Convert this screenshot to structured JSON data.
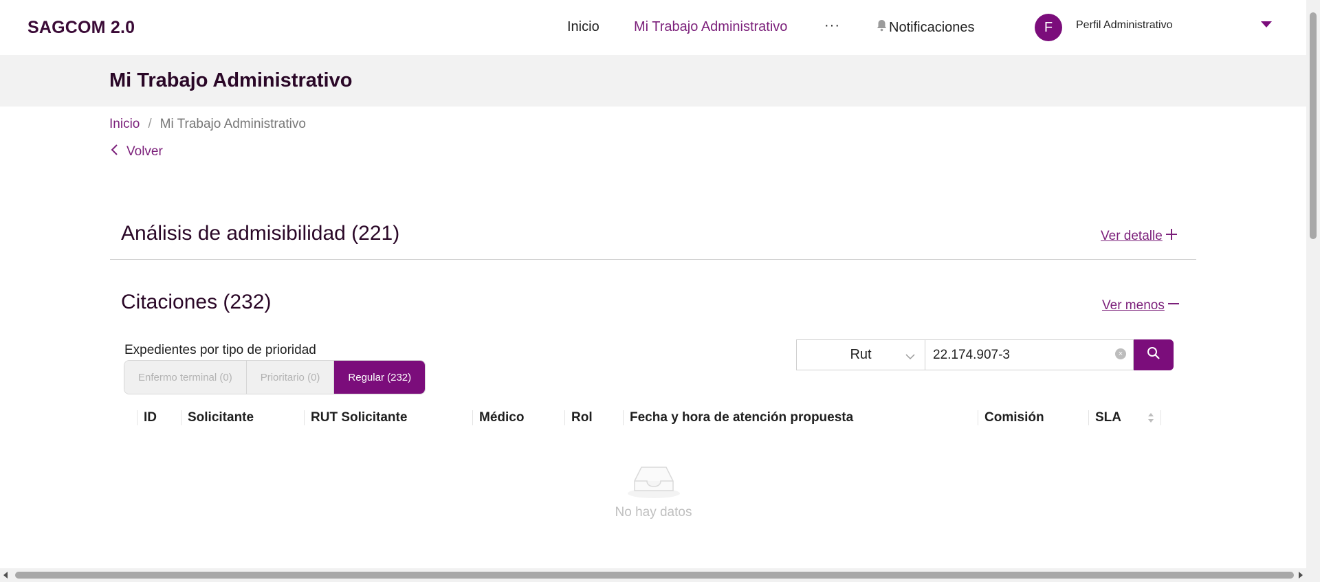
{
  "header": {
    "brand": "SAGCOM 2.0",
    "nav": [
      "Inicio",
      "Mi Trabajo Administrativo"
    ],
    "more": "···",
    "notifications": "Notificaciones",
    "avatar_initial": "F",
    "profile": "Perfil Administrativo"
  },
  "page": {
    "title": "Mi Trabajo Administrativo",
    "breadcrumb": [
      "Inicio",
      "Mi Trabajo Administrativo"
    ],
    "breadcrumb_sep": "/",
    "back": "Volver"
  },
  "sections": {
    "admisibilidad": {
      "title": "Análisis de admisibilidad (221)",
      "link": "Ver detalle"
    },
    "citaciones": {
      "title": "Citaciones (232)",
      "link": "Ver menos"
    }
  },
  "priority": {
    "label": "Expedientes por tipo de prioridad",
    "options": [
      "Enfermo terminal (0)",
      "Prioritario (0)",
      "Regular (232)"
    ],
    "selected": "Regular (232)"
  },
  "search": {
    "field": "Rut",
    "value": "22.174.907-3"
  },
  "table": {
    "columns": [
      "ID",
      "Solicitante",
      "RUT Solicitante",
      "Médico",
      "Rol",
      "Fecha y hora de atención propuesta",
      "Comisión",
      "SLA"
    ],
    "empty": "No hay datos"
  },
  "colors": {
    "accent": "#7b0d7b",
    "title": "#2a0727"
  }
}
